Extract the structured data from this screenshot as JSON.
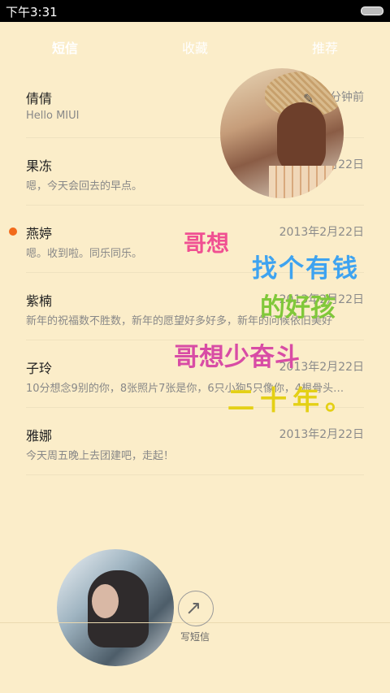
{
  "statusbar": {
    "time": "下午3:31",
    "battery_icon": "battery-icon"
  },
  "tabs": [
    {
      "label": "短信",
      "active": true
    },
    {
      "label": "收藏",
      "active": false
    },
    {
      "label": "推荐",
      "active": false
    }
  ],
  "messages": [
    {
      "name": "倩倩",
      "time": "8分钟前",
      "snippet": "Hello MIUI",
      "unread": false
    },
    {
      "name": "果冻",
      "time": "2013年2月22日",
      "snippet": "嗯，今天会回去的早点。",
      "unread": false
    },
    {
      "name": "燕婷",
      "time": "2013年2月22日",
      "snippet": "嗯。收到啦。同乐同乐。",
      "unread": true
    },
    {
      "name": "紫楠",
      "time": "2013年2月22日",
      "snippet": "新年的祝福数不胜数，新年的愿望好多好多，新年的问候依旧美好",
      "unread": false
    },
    {
      "name": "子玲",
      "time": "2013年2月22日",
      "snippet": "10分想念9别的你，8张照片7张是你，6只小狗5只像你，4根骨头…",
      "unread": false
    },
    {
      "name": "雅娜",
      "time": "2013年2月22日",
      "snippet": "今天周五晚上去团建吧，走起！",
      "unread": false
    }
  ],
  "overlay": {
    "line1": "哥想",
    "line2": "找个有钱",
    "line3": "的好孩",
    "line4": "哥想少奋斗",
    "line5": "二十年。"
  },
  "compose": {
    "label": "写短信",
    "icon": "compose-icon"
  },
  "colors": {
    "background": "#fbedc9",
    "unread_dot": "#f26a1b",
    "statusbar": "#000000"
  }
}
